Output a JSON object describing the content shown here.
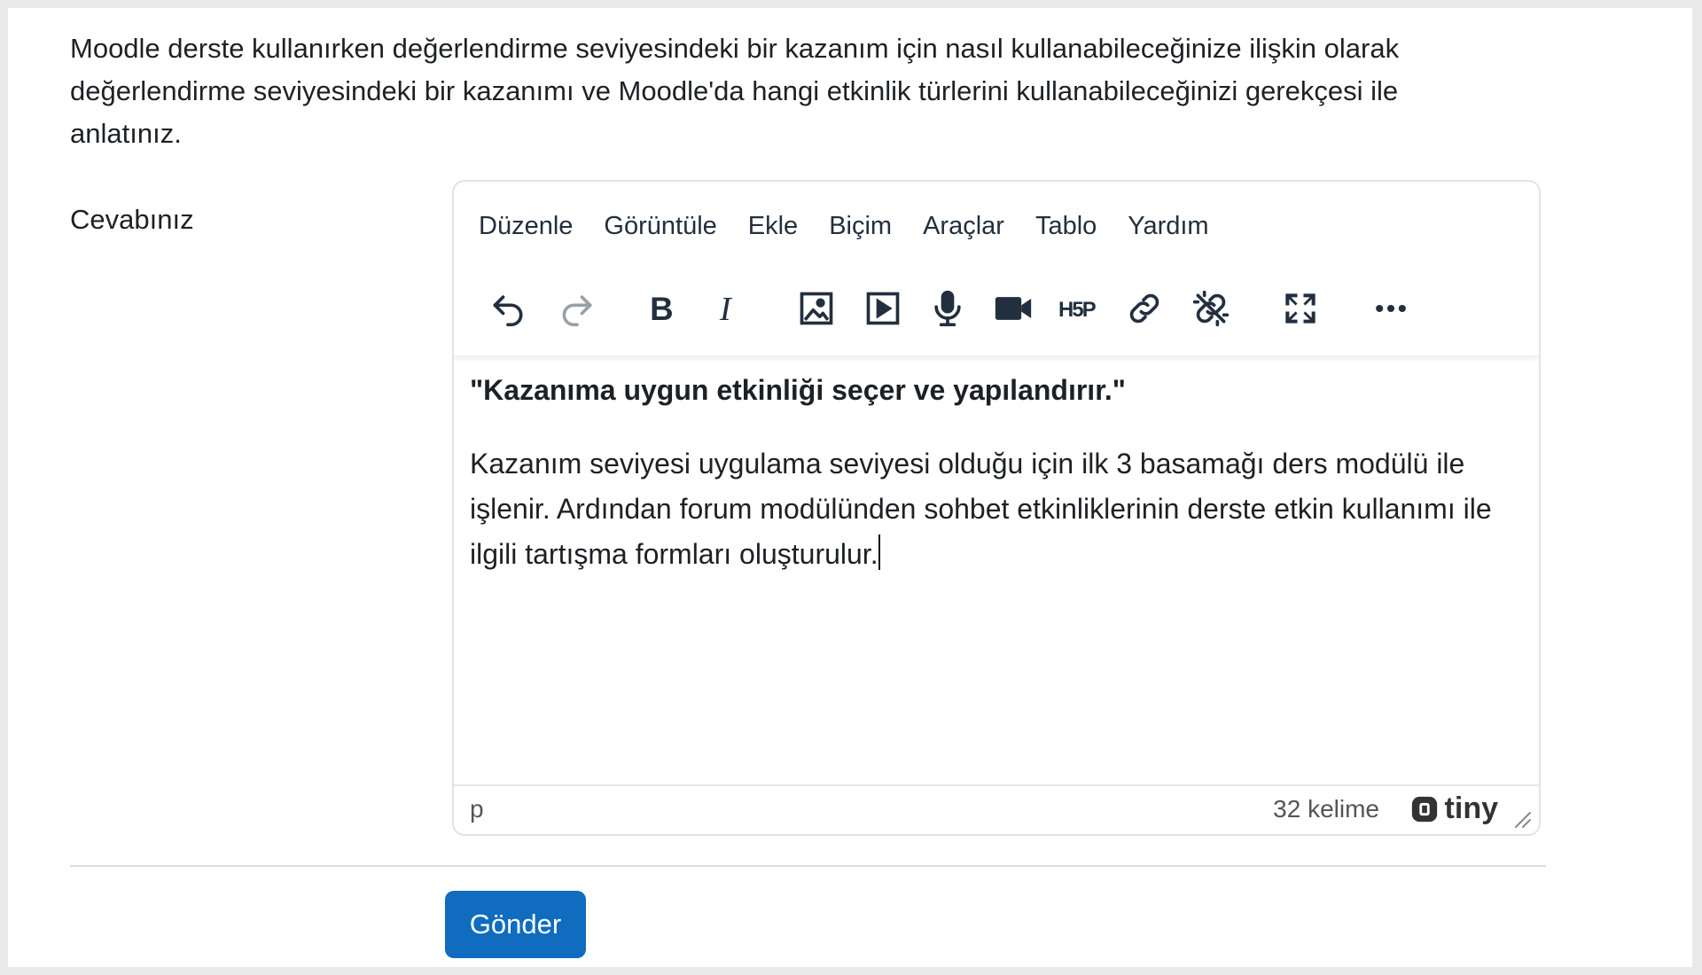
{
  "question": {
    "text": "Moodle derste kullanırken değerlendirme seviyesindeki bir kazanım için nasıl kullanabileceğinize ilişkin olarak değerlendirme seviyesindeki bir kazanımı ve Moodle'da hangi etkinlik türlerini kullanabileceğinizi gerekçesi ile anlatınız."
  },
  "answer_label": "Cevabınız",
  "editor": {
    "menu": [
      "Düzenle",
      "Görüntüle",
      "Ekle",
      "Biçim",
      "Araçlar",
      "Tablo",
      "Yardım"
    ],
    "toolbar_icons": [
      "undo-icon",
      "redo-icon",
      "bold-icon",
      "italic-icon",
      "image-icon",
      "media-icon",
      "microphone-icon",
      "video-camera-icon",
      "h5p-icon",
      "link-icon",
      "unlink-icon",
      "fullscreen-icon",
      "more-icon"
    ],
    "content": {
      "heading": "\"Kazanıma uygun etkinliği seçer ve yapılandırır.\"",
      "body": "Kazanım seviyesi uygulama seviyesi olduğu için ilk 3 basamağı ders modülü ile işlenir. Ardından forum modülünden sohbet etkinliklerinin derste etkin kullanımı ile ilgili tartışma formları oluşturulur."
    },
    "status_path": "p",
    "word_count": "32 kelime",
    "brand": "tiny"
  },
  "submit_label": "Gönder",
  "colors": {
    "primary": "#0f6cbf",
    "text": "#1d2125"
  }
}
